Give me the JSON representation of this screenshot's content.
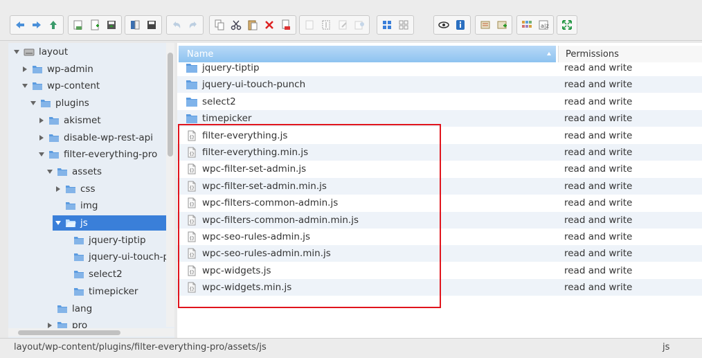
{
  "toolbar": {
    "groups": [
      [
        "back",
        "forward",
        "up"
      ],
      [
        "mkdir",
        "mkfile",
        "upload"
      ],
      [
        "open",
        "download"
      ],
      [
        "undo",
        "redo"
      ],
      [
        "copy",
        "cut",
        "paste",
        "delete",
        "empty"
      ],
      [
        "duplicate",
        "rename",
        "edit",
        "extract"
      ],
      [
        "view-icons",
        "view-list"
      ],
      [
        "preview",
        "info"
      ],
      [
        "select-all",
        "select-none"
      ],
      [
        "sort",
        "search"
      ],
      [
        "fullscreen"
      ]
    ]
  },
  "tree": {
    "items": [
      {
        "label": "layout",
        "level": 0,
        "expanded": true,
        "icon": "drive-icon",
        "has_children": true
      },
      {
        "label": "wp-admin",
        "level": 1,
        "expanded": false,
        "icon": "folder-icon",
        "has_children": true
      },
      {
        "label": "wp-content",
        "level": 1,
        "expanded": true,
        "icon": "folder-icon",
        "has_children": true
      },
      {
        "label": "plugins",
        "level": 2,
        "expanded": true,
        "icon": "folder-icon",
        "has_children": true
      },
      {
        "label": "akismet",
        "level": 3,
        "expanded": false,
        "icon": "folder-icon",
        "has_children": true
      },
      {
        "label": "disable-wp-rest-api",
        "level": 3,
        "expanded": false,
        "icon": "folder-icon",
        "has_children": true
      },
      {
        "label": "filter-everything-pro",
        "level": 3,
        "expanded": true,
        "icon": "folder-icon",
        "has_children": true
      },
      {
        "label": "assets",
        "level": 4,
        "expanded": true,
        "icon": "folder-icon",
        "has_children": true
      },
      {
        "label": "css",
        "level": 5,
        "expanded": false,
        "icon": "folder-icon",
        "has_children": true
      },
      {
        "label": "img",
        "level": 5,
        "expanded": false,
        "icon": "folder-icon",
        "has_children": false
      },
      {
        "label": "js",
        "level": 5,
        "expanded": true,
        "icon": "folder-open-icon",
        "has_children": true,
        "selected": true
      },
      {
        "label": "jquery-tiptip",
        "level": 6,
        "expanded": false,
        "icon": "folder-icon",
        "has_children": false
      },
      {
        "label": "jquery-ui-touch-punch",
        "level": 6,
        "expanded": false,
        "icon": "folder-icon",
        "has_children": false
      },
      {
        "label": "select2",
        "level": 6,
        "expanded": false,
        "icon": "folder-icon",
        "has_children": false
      },
      {
        "label": "timepicker",
        "level": 6,
        "expanded": false,
        "icon": "folder-icon",
        "has_children": false
      },
      {
        "label": "lang",
        "level": 4,
        "expanded": false,
        "icon": "folder-icon",
        "has_children": false
      },
      {
        "label": "pro",
        "level": 4,
        "expanded": false,
        "icon": "folder-icon",
        "has_children": true
      }
    ]
  },
  "files": {
    "columns": {
      "name": "Name",
      "permissions": "Permissions"
    },
    "rows": [
      {
        "name": "jquery-tiptip",
        "type": "folder",
        "permissions": "read and write"
      },
      {
        "name": "jquery-ui-touch-punch",
        "type": "folder",
        "permissions": "read and write"
      },
      {
        "name": "select2",
        "type": "folder",
        "permissions": "read and write"
      },
      {
        "name": "timepicker",
        "type": "folder",
        "permissions": "read and write"
      },
      {
        "name": "filter-everything.js",
        "type": "js",
        "permissions": "read and write"
      },
      {
        "name": "filter-everything.min.js",
        "type": "js",
        "permissions": "read and write"
      },
      {
        "name": "wpc-filter-set-admin.js",
        "type": "js",
        "permissions": "read and write"
      },
      {
        "name": "wpc-filter-set-admin.min.js",
        "type": "js",
        "permissions": "read and write"
      },
      {
        "name": "wpc-filters-common-admin.js",
        "type": "js",
        "permissions": "read and write"
      },
      {
        "name": "wpc-filters-common-admin.min.js",
        "type": "js",
        "permissions": "read and write"
      },
      {
        "name": "wpc-seo-rules-admin.js",
        "type": "js",
        "permissions": "read and write"
      },
      {
        "name": "wpc-seo-rules-admin.min.js",
        "type": "js",
        "permissions": "read and write"
      },
      {
        "name": "wpc-widgets.js",
        "type": "js",
        "permissions": "read and write"
      },
      {
        "name": "wpc-widgets.min.js",
        "type": "js",
        "permissions": "read and write"
      }
    ]
  },
  "status": {
    "path": "layout/wp-content/plugins/filter-everything-pro/assets/js",
    "selected": "js"
  },
  "colors": {
    "accent": "#3a7fd9",
    "highlight_border": "#e0141c",
    "folder": "#5b9be0"
  }
}
